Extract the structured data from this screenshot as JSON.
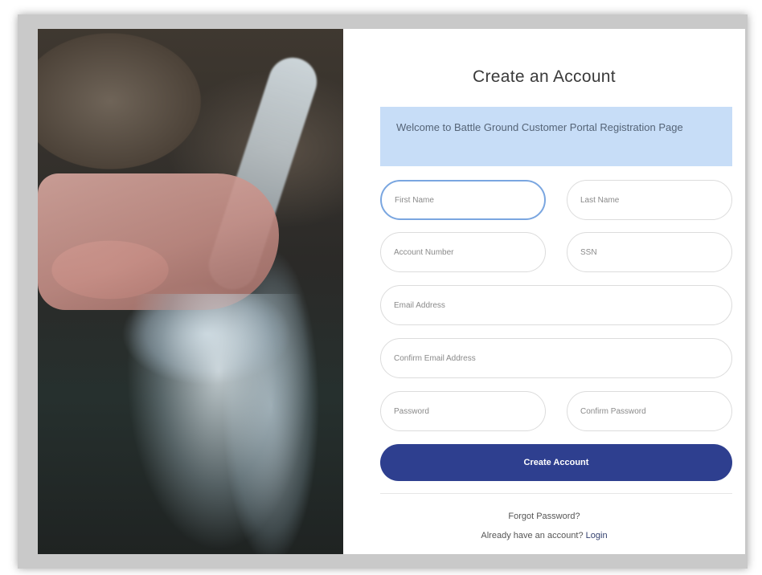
{
  "form": {
    "title": "Create an Account",
    "welcome_message": "Welcome to Battle Ground Customer Portal Registration Page",
    "fields": {
      "first_name": "First Name",
      "last_name": "Last Name",
      "account_number": "Account Number",
      "ssn": "SSN",
      "email": "Email Address",
      "confirm_email": "Confirm Email Address",
      "password": "Password",
      "confirm_password": "Confirm Password"
    },
    "create_button": "Create Account",
    "forgot_password": "Forgot Password?",
    "have_account_text": "Already have an account?",
    "login_link": "Login"
  },
  "colors": {
    "primary_button": "#2e3f8f",
    "alert_background": "#c7ddf7",
    "focus_border": "#7aa6e0"
  }
}
